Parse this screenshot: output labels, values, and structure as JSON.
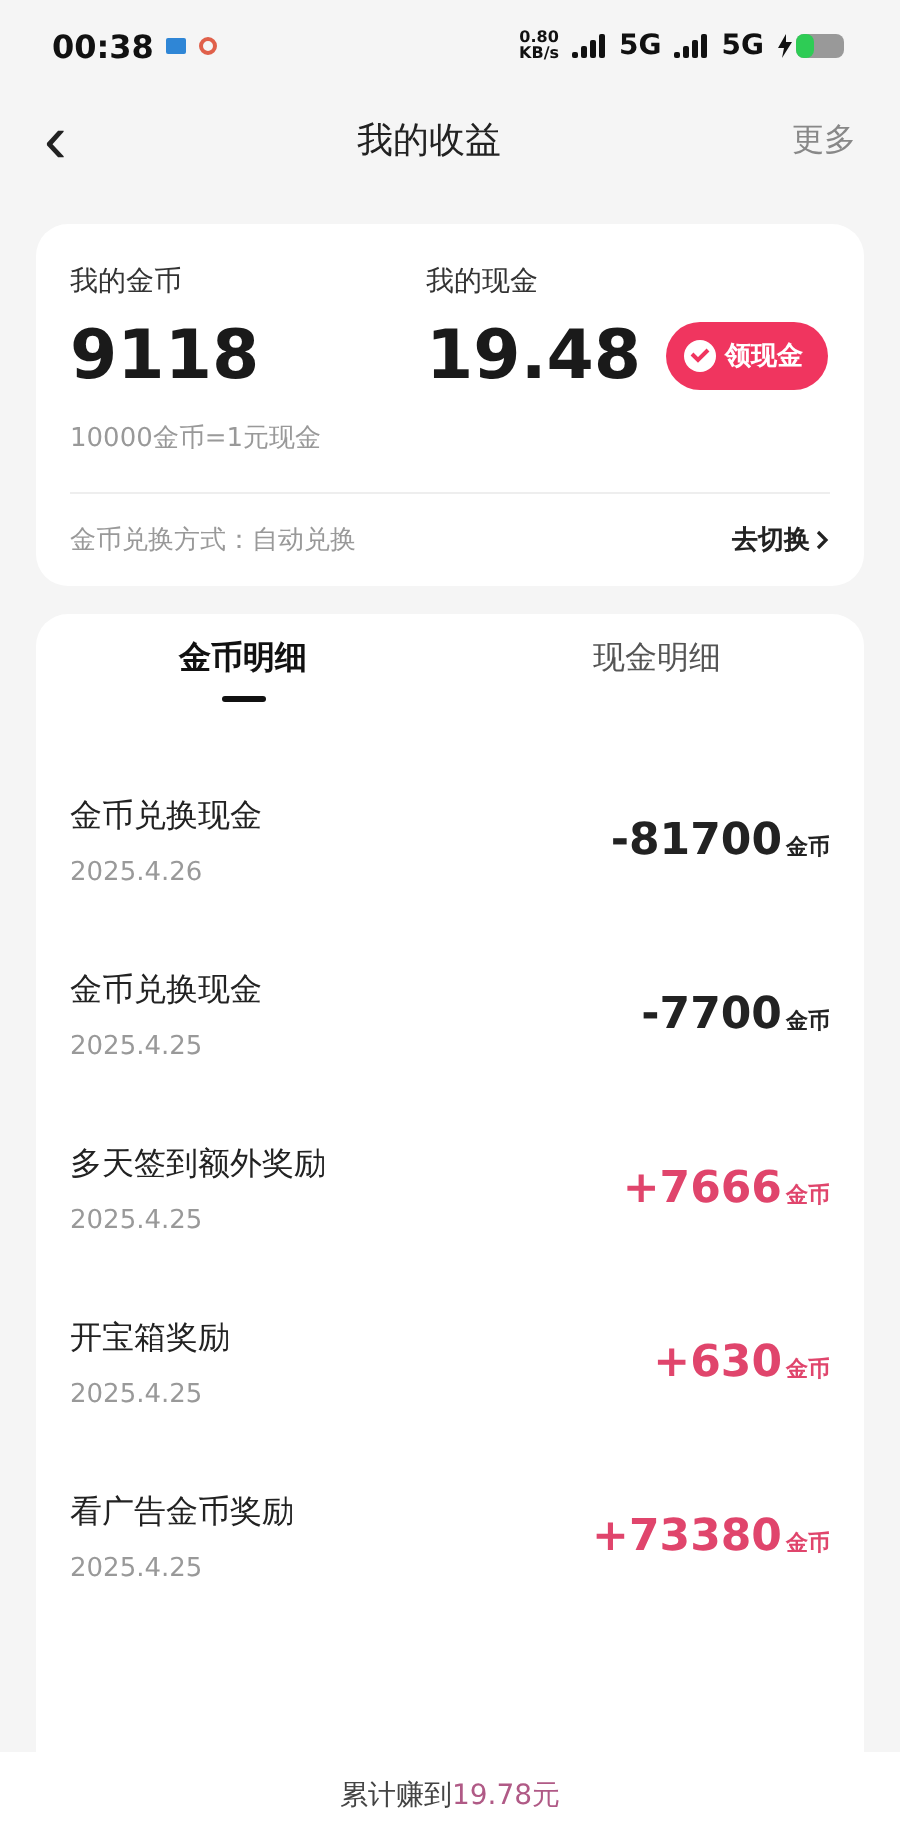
{
  "status_bar": {
    "time": "00:38",
    "speed": "0.80",
    "speed_unit": "KB/s",
    "network_1": "5G",
    "network_2": "5G"
  },
  "nav": {
    "back": "‹",
    "title": "我的收益",
    "more": "更多"
  },
  "summary": {
    "coins_label": "我的金币",
    "coins": "9118",
    "cash_label": "我的现金",
    "cash": "19.48",
    "withdraw_button": "领现金",
    "rate": "10000金币=1元现金",
    "mode": "金币兑换方式：自动兑换",
    "switch_link": "去切换"
  },
  "tabs": [
    {
      "label": "金币明细",
      "selected": true
    },
    {
      "label": "现金明细",
      "selected": false
    }
  ],
  "records": [
    {
      "title": "金币兑换现金",
      "date": "2025.4.26",
      "amount": "-81700",
      "unit": "金币",
      "kind": "expense"
    },
    {
      "title": "金币兑换现金",
      "date": "2025.4.25",
      "amount": "-7700",
      "unit": "金币",
      "kind": "expense"
    },
    {
      "title": "多天签到额外奖励",
      "date": "2025.4.25",
      "amount": "+7666",
      "unit": "金币",
      "kind": "income"
    },
    {
      "title": "开宝箱奖励",
      "date": "2025.4.25",
      "amount": "+630",
      "unit": "金币",
      "kind": "income"
    },
    {
      "title": "看广告金币奖励",
      "date": "2025.4.25",
      "amount": "+73380",
      "unit": "金币",
      "kind": "income"
    }
  ],
  "footer": {
    "label": "累计赚到",
    "amount": "19.78元"
  }
}
